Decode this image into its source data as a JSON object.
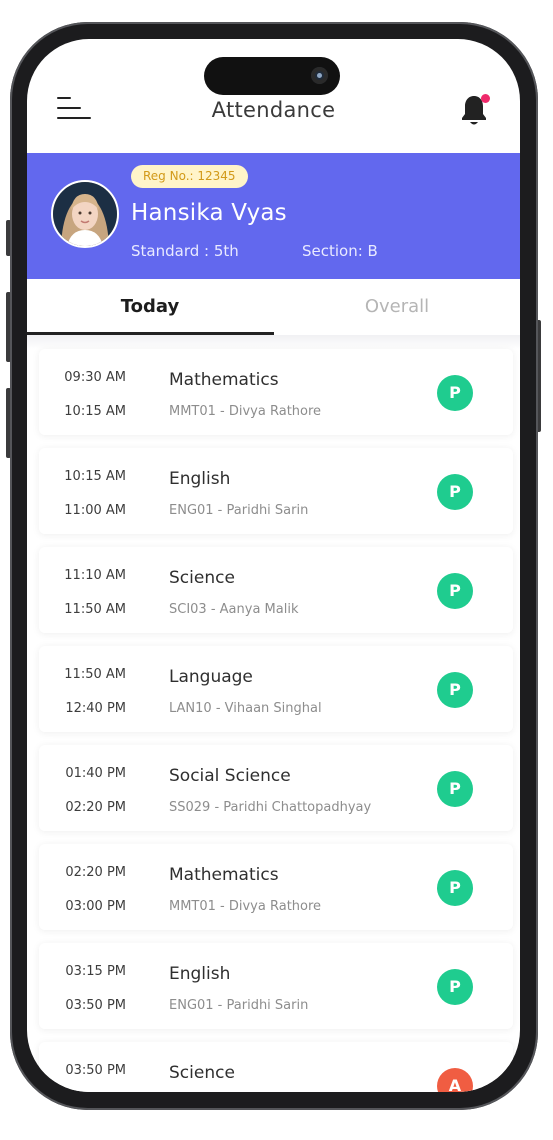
{
  "header": {
    "title": "Attendance"
  },
  "profile": {
    "reg_no": "Reg No.: 12345",
    "name": "Hansika Vyas",
    "standard": "Standard : 5th",
    "section": "Section: B"
  },
  "tabs": [
    {
      "label": "Today",
      "active": true
    },
    {
      "label": "Overall",
      "active": false
    }
  ],
  "colors": {
    "profile_bg": "#6268ee",
    "present": "#1fcc8f",
    "absent": "#f05d42",
    "notification_dot": "#ef2a6b"
  },
  "sessions": [
    {
      "start": "09:30 AM",
      "end": "10:15 AM",
      "subject": "Mathematics",
      "code": "MMT01 - Divya Rathore",
      "status": "P"
    },
    {
      "start": "10:15 AM",
      "end": "11:00 AM",
      "subject": "English",
      "code": "ENG01 - Paridhi Sarin",
      "status": "P"
    },
    {
      "start": "11:10 AM",
      "end": "11:50 AM",
      "subject": "Science",
      "code": "SCI03 - Aanya Malik",
      "status": "P"
    },
    {
      "start": "11:50 AM",
      "end": "12:40 PM",
      "subject": "Language",
      "code": "LAN10 - Vihaan Singhal",
      "status": "P"
    },
    {
      "start": "01:40 PM",
      "end": "02:20 PM",
      "subject": "Social Science",
      "code": "SS029 - Paridhi Chattopadhyay",
      "status": "P"
    },
    {
      "start": "02:20 PM",
      "end": "03:00 PM",
      "subject": "Mathematics",
      "code": "MMT01 - Divya Rathore",
      "status": "P"
    },
    {
      "start": "03:15 PM",
      "end": "03:50 PM",
      "subject": "English",
      "code": "ENG01 - Paridhi Sarin",
      "status": "P"
    },
    {
      "start": "03:50 PM",
      "end": "",
      "subject": "Science",
      "code": "",
      "status": "A"
    }
  ]
}
